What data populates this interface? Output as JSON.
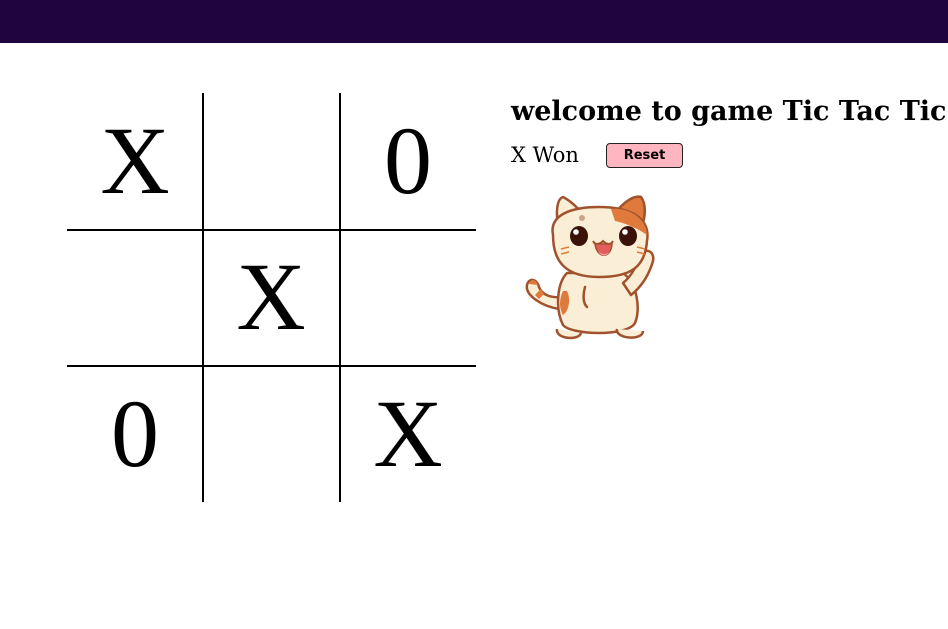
{
  "colors": {
    "header_bar": "#1f0440",
    "reset_button_bg": "#ffb6c1",
    "board_lines": "#000000"
  },
  "board": {
    "cells": [
      "X",
      "",
      "0",
      "",
      "X",
      "",
      "0",
      "",
      "X"
    ]
  },
  "info": {
    "title": "welcome to game Tic Tac Tic",
    "status": "X Won",
    "reset_label": "Reset",
    "mascot": "cat-mascot-waving"
  }
}
